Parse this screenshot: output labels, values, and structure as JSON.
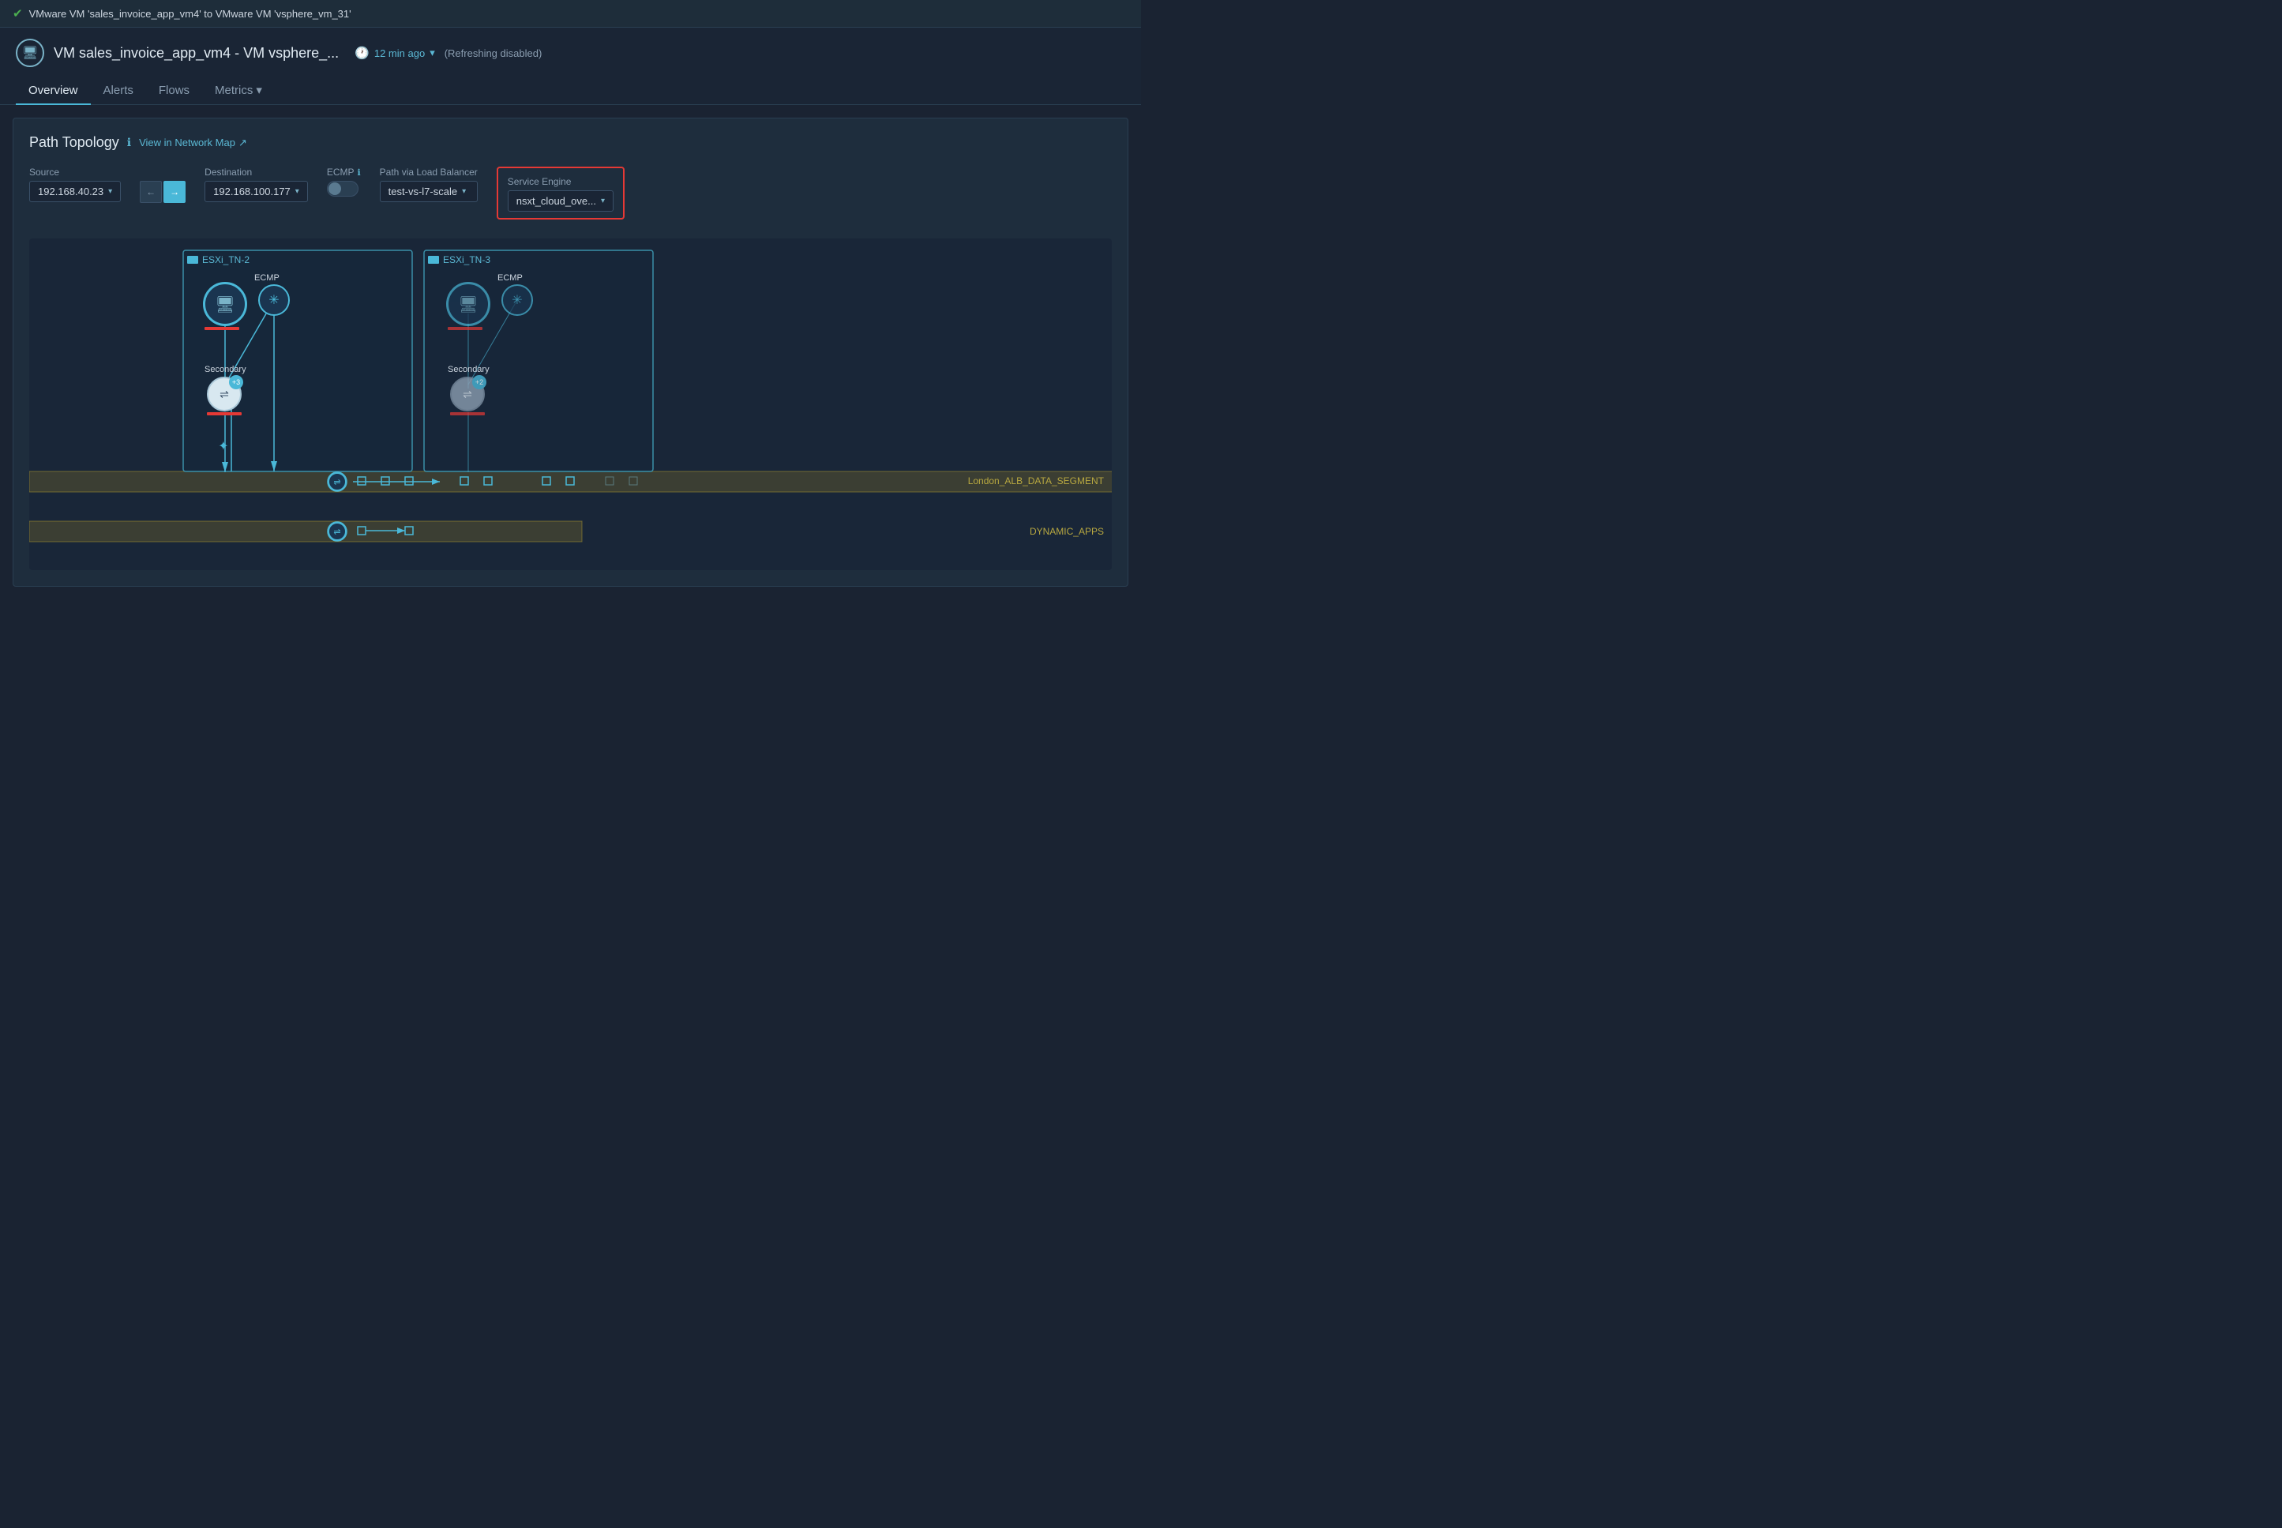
{
  "notification": {
    "message": "VMware VM 'sales_invoice_app_vm4' to VMware VM 'vsphere_vm_31'"
  },
  "header": {
    "vm_icon": "🖥",
    "title": "VM sales_invoice_app_vm4 - VM vsphere_...",
    "time": "12 min ago",
    "refreshing": "(Refreshing  disabled)"
  },
  "nav": {
    "tabs": [
      {
        "label": "Overview",
        "active": true
      },
      {
        "label": "Alerts",
        "active": false
      },
      {
        "label": "Flows",
        "active": false
      },
      {
        "label": "Metrics",
        "active": false,
        "has_dropdown": true
      }
    ]
  },
  "section": {
    "title": "Path Topology",
    "view_link": "View in Network Map"
  },
  "controls": {
    "source_label": "Source",
    "source_value": "192.168.40.23",
    "destination_label": "Destination",
    "destination_value": "192.168.100.177",
    "ecmp_label": "ECMP",
    "path_via_lb_label": "Path via Load Balancer",
    "path_via_lb_value": "test-vs-l7-scale",
    "service_engine_label": "Service Engine",
    "service_engine_value": "nsxt_cloud_ove...",
    "arrow_left": "←",
    "arrow_right": "→"
  },
  "topology": {
    "esxi_left": {
      "name": "ESXi_TN-2",
      "ecmp_label": "ECMP",
      "secondary_label": "Secondary",
      "secondary_badge": "+3"
    },
    "esxi_right": {
      "name": "ESXi_TN-3",
      "ecmp_label": "ECMP",
      "secondary_label": "Secondary",
      "secondary_badge": "+2"
    },
    "segment1_label": "London_ALB_DATA_SEGMENT",
    "segment2_label": "DYNAMIC_APPS"
  }
}
